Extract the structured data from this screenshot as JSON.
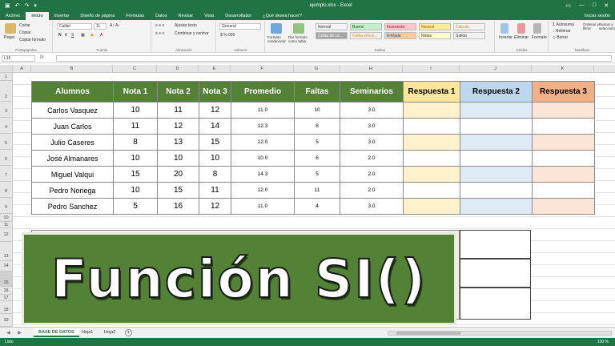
{
  "titlebar": {
    "title": "ejemplo.xlsx - Excel"
  },
  "tabs": [
    "Archivo",
    "Inicio",
    "Insertar",
    "Diseño de página",
    "Fórmulas",
    "Datos",
    "Revisar",
    "Vista",
    "Desarrollador",
    "¿Qué desea hacer?"
  ],
  "tabs_right": "Iniciar sesión",
  "ribbon": {
    "paste": "Pegar",
    "cut": "Cortar",
    "copy": "Copiar",
    "format_painter": "Copiar formato",
    "font_name": "Calibri",
    "font_size": "11",
    "wrap_text": "Ajustar texto",
    "merge_center": "Combinar y centrar",
    "number_format": "General",
    "cond_format": "Formato condicional",
    "format_table": "Dar formato como tabla",
    "styles": [
      {
        "label": "Normal",
        "bg": "#ffffff",
        "fg": "#000000"
      },
      {
        "label": "Bueno",
        "bg": "#c6efce",
        "fg": "#006100"
      },
      {
        "label": "Incorrecto",
        "bg": "#ffc7ce",
        "fg": "#9c0006"
      },
      {
        "label": "Neutral",
        "bg": "#ffeb9c",
        "fg": "#9c5700"
      },
      {
        "label": "Cálculo",
        "bg": "#f2f2f2",
        "fg": "#fa7d00"
      },
      {
        "label": "Celda de co...",
        "bg": "#a5a5a5",
        "fg": "#ffffff"
      },
      {
        "label": "Celda vincul...",
        "bg": "#ffffff",
        "fg": "#fa7d00"
      },
      {
        "label": "Entrada",
        "bg": "#ffcc99",
        "fg": "#3f3f76"
      },
      {
        "label": "Notas",
        "bg": "#ffffcc",
        "fg": "#000000"
      },
      {
        "label": "Salida",
        "bg": "#f2f2f2",
        "fg": "#3f3f3f"
      }
    ],
    "insert": "Insertar",
    "delete": "Eliminar",
    "format": "Formato",
    "autosum": "Autosuma",
    "fill": "Rellenar",
    "clear": "Borrar",
    "sort_filter": "Ordenar y filtrar",
    "find_select": "Buscar y seleccionar",
    "groups": [
      "Portapapeles",
      "Fuente",
      "Alineación",
      "Número",
      "Estilos",
      "Celdas",
      "Modificar"
    ]
  },
  "formula_bar": {
    "name_box": "L15",
    "fx": "fx"
  },
  "columns": [
    "A",
    "B",
    "C",
    "D",
    "E",
    "F",
    "G",
    "H",
    "I",
    "J",
    "K"
  ],
  "rows": [
    "1",
    "2",
    "3",
    "4",
    "5",
    "6",
    "7",
    "8",
    "9",
    "10",
    "11",
    "12",
    "13",
    "14",
    "15",
    "16",
    "17",
    "18",
    "19"
  ],
  "table": {
    "headers": [
      "Alumnos",
      "Nota 1",
      "Nota 2",
      "Nota 3",
      "Promedio",
      "Faltas",
      "Seminarios",
      "Respuesta 1",
      "Respuesta 2",
      "Respuesta 3"
    ],
    "rows": [
      [
        "Carlos Vasquez",
        "10",
        "11",
        "12",
        "11.0",
        "10",
        "3.0"
      ],
      [
        "Juan Carlos",
        "11",
        "12",
        "14",
        "12.3",
        "8",
        "3.0"
      ],
      [
        "Julio Caseres",
        "8",
        "13",
        "15",
        "12.0",
        "5",
        "3.0"
      ],
      [
        "José Almanares",
        "10",
        "10",
        "10",
        "10.0",
        "6",
        "2.0"
      ],
      [
        "Miguel Valqui",
        "15",
        "20",
        "8",
        "14.3",
        "5",
        "2.0"
      ],
      [
        "Pedro Noriega",
        "10",
        "15",
        "11",
        "12.0",
        "11",
        "2.0"
      ],
      [
        "Pedro Sanchez",
        "5",
        "16",
        "12",
        "11.0",
        "4",
        "3.0"
      ]
    ]
  },
  "banner": {
    "text": "Función SI()"
  },
  "sheets": [
    "BASE DE DATOS",
    "Hoja1",
    "Hoja2"
  ],
  "status": {
    "ready": "Listo",
    "zoom": "100 %"
  }
}
